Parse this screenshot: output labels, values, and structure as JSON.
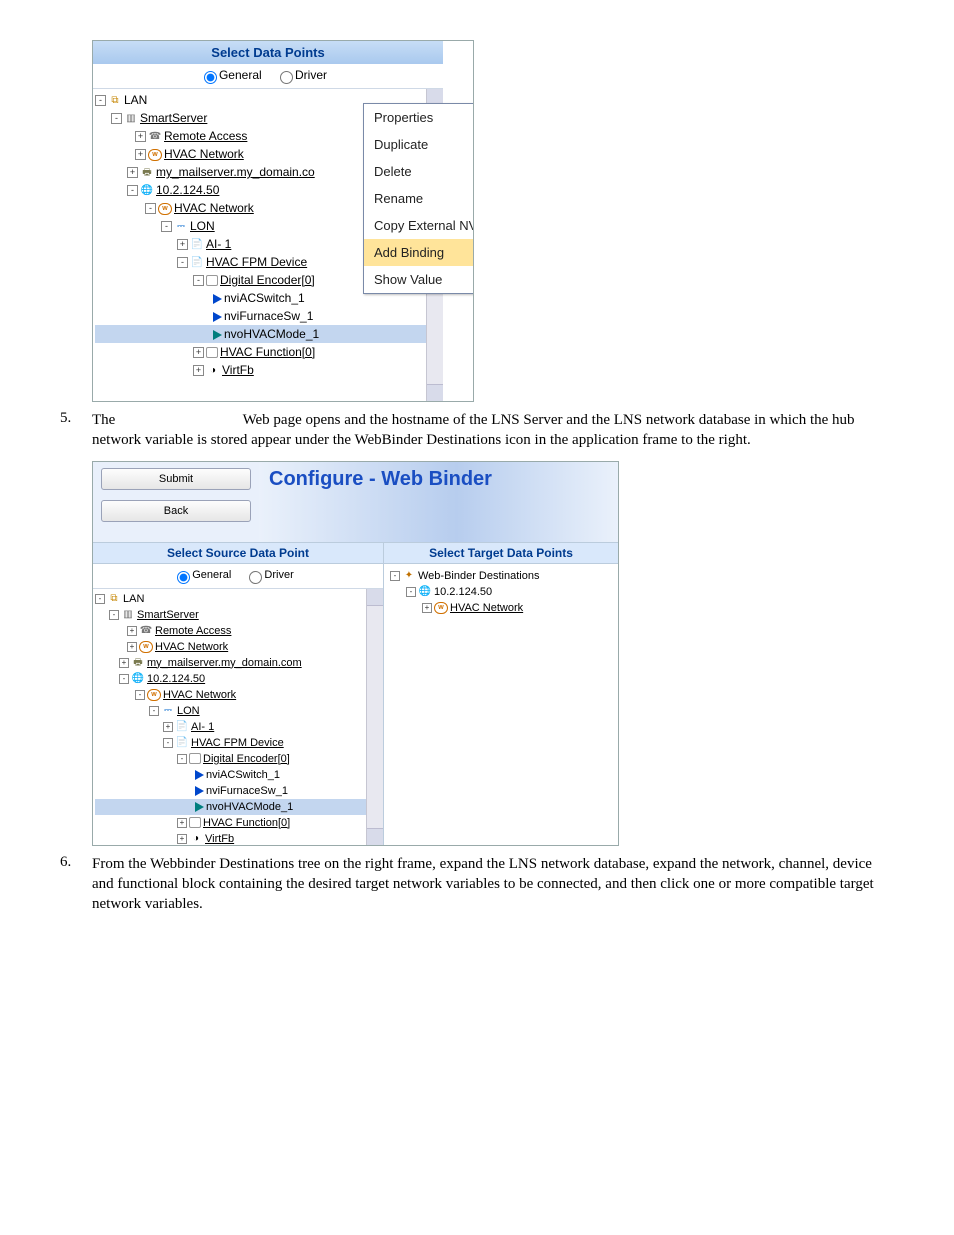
{
  "screenshot1": {
    "title": "Select Data Points",
    "radio_general": "General",
    "radio_driver": "Driver",
    "tree": {
      "lan": "LAN",
      "smartserver": "SmartServer",
      "remote_access": "Remote Access",
      "hvac_network_1": "HVAC Network",
      "mailserver": "my_mailserver.my_domain.co",
      "ip": "10.2.124.50",
      "hvac_network_2": "HVAC Network",
      "lon": "LON",
      "ai1": "AI- 1",
      "hvac_fpm": "HVAC FPM Device",
      "dig_enc": "Digital Encoder[0]",
      "nv_ac": "nviACSwitch_1",
      "nv_furnace": "nviFurnaceSw_1",
      "nv_mode": "nvoHVACMode_1",
      "hvac_func": "HVAC Function[0]",
      "virtfb": "VirtFb"
    },
    "context_menu": {
      "properties": "Properties",
      "duplicate": "Duplicate",
      "delete": "Delete",
      "rename": "Rename",
      "copy_ext": "Copy External NV",
      "add_binding": "Add Binding",
      "show_value": "Show Value"
    }
  },
  "step5": {
    "num": "5.",
    "text_before": "The",
    "text_after": "Web page opens and the hostname of the LNS Server and the LNS network database in which the hub network variable is stored appear under the WebBinder Destinations icon in the application frame to the right."
  },
  "screenshot2": {
    "submit": "Submit",
    "back": "Back",
    "title": "Configure - Web Binder",
    "left_title": "Select Source Data Point",
    "right_title": "Select Target Data Points",
    "radio_general": "General",
    "radio_driver": "Driver",
    "left_tree": {
      "lan": "LAN",
      "smartserver": "SmartServer",
      "remote_access": "Remote Access",
      "hvac_network_1": "HVAC Network",
      "mailserver": "my_mailserver.my_domain.com",
      "ip": "10.2.124.50",
      "hvac_network_2": "HVAC Network",
      "lon": "LON",
      "ai1": "AI- 1",
      "hvac_fpm": "HVAC FPM Device",
      "dig_enc": "Digital Encoder[0]",
      "nv_ac": "nviACSwitch_1",
      "nv_furnace": "nviFurnaceSw_1",
      "nv_mode": "nvoHVACMode_1",
      "hvac_func": "HVAC Function[0]",
      "virtfb": "VirtFb"
    },
    "right_tree": {
      "root": "Web-Binder Destinations",
      "ip": "10.2.124.50",
      "hvac_net": "HVAC Network"
    }
  },
  "step6": {
    "num": "6.",
    "text": "From the Webbinder Destinations tree on the right frame, expand the LNS network database, expand the network, channel, device and functional block containing the desired target network variables to be connected, and then click one or more compatible target network variables."
  }
}
